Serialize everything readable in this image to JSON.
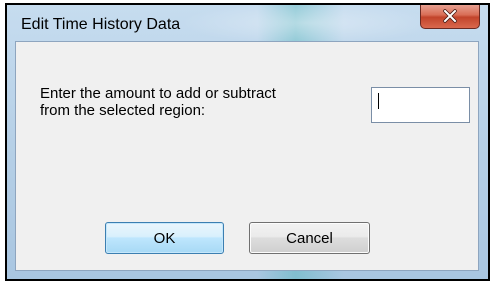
{
  "dialog": {
    "title": "Edit Time History Data",
    "prompt": "Enter the amount to add or subtract\nfrom the selected region:",
    "amount": {
      "value": "",
      "placeholder": ""
    },
    "buttons": {
      "ok_label": "OK",
      "cancel_label": "Cancel"
    }
  },
  "icons": {
    "close": "close-icon"
  },
  "colors": {
    "frame": "#b5cfe6",
    "client": "#f0f0f0",
    "close_button": "#c2442b",
    "default_button_border": "#3c7fb1"
  }
}
